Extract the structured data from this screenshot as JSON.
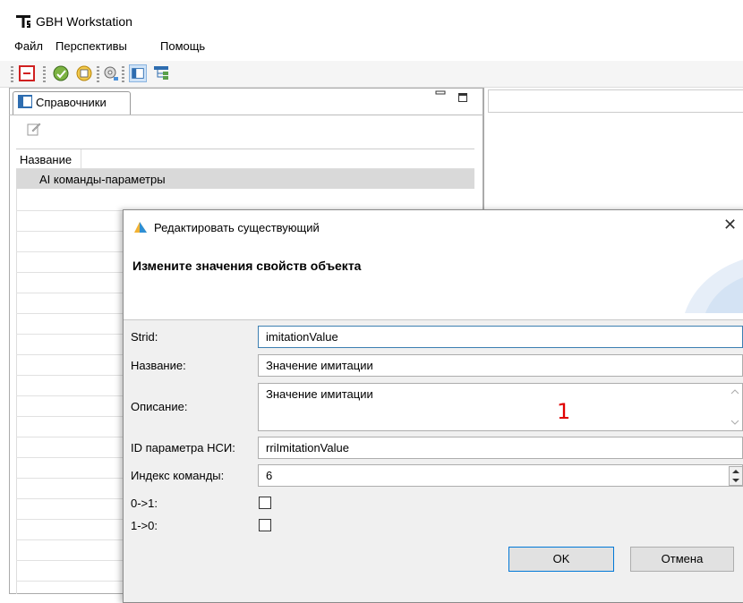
{
  "app": {
    "title": "GBH Workstation"
  },
  "menu": [
    "Файл",
    "Перспективы",
    "Помощь"
  ],
  "left_panel": {
    "tab_label": "Справочники",
    "column_header": "Название",
    "rows": [
      "AI команды-параметры"
    ]
  },
  "dialog": {
    "title": "Редактировать существующий",
    "heading": "Измените значения свойств объекта",
    "fields": {
      "strid": {
        "label": "Strid:",
        "value": "imitationValue"
      },
      "name": {
        "label": "Название:",
        "value": "Значение имитации"
      },
      "description": {
        "label": "Описание:",
        "value": "Значение имитации"
      },
      "nsi_id": {
        "label": "ID параметра НСИ:",
        "value": "rriImitationValue"
      },
      "command_index": {
        "label": "Индекс команды:",
        "value": "6"
      },
      "zero_to_one": {
        "label": "0->1:",
        "checked": false
      },
      "one_to_zero": {
        "label": "1->0:",
        "checked": false
      }
    },
    "annotation": "1",
    "ok_label": "OK",
    "cancel_label": "Отмена"
  },
  "colors": {
    "accent": "#0078d7",
    "annotation": "#e00000",
    "selection": "#d9d9d9"
  }
}
